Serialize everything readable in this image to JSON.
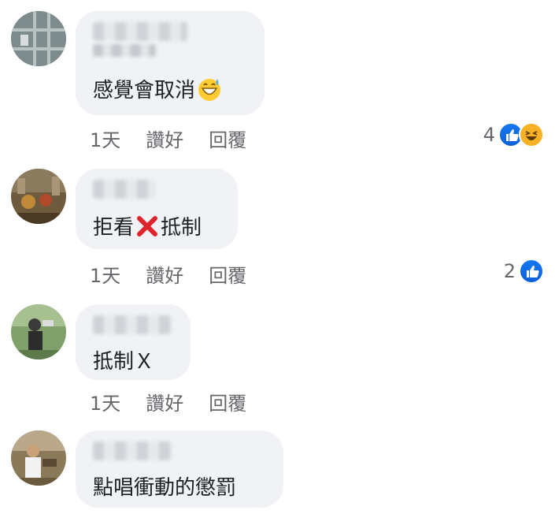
{
  "comments": [
    {
      "text": "感覺會取消",
      "emoji": "grinning-sweat-emoji",
      "time": "1天",
      "like_label": "讚好",
      "reply_label": "回覆",
      "reaction_count": "4",
      "reactions": [
        "like-icon",
        "haha-icon"
      ]
    },
    {
      "text_before": "拒看",
      "emoji": "red-cross-emoji",
      "text_after": "抵制",
      "time": "1天",
      "like_label": "讚好",
      "reply_label": "回覆",
      "reaction_count": "2",
      "reactions": [
        "like-icon"
      ]
    },
    {
      "text": "抵制Ｘ",
      "time": "1天",
      "like_label": "讚好",
      "reply_label": "回覆"
    },
    {
      "text": "點唱衝動的懲罰"
    }
  ],
  "colors": {
    "bubble": "#f0f2f5",
    "text": "#1c1e21",
    "meta": "#65676b",
    "like_blue": "#1877f2",
    "haha_yellow": "#f7b125"
  }
}
